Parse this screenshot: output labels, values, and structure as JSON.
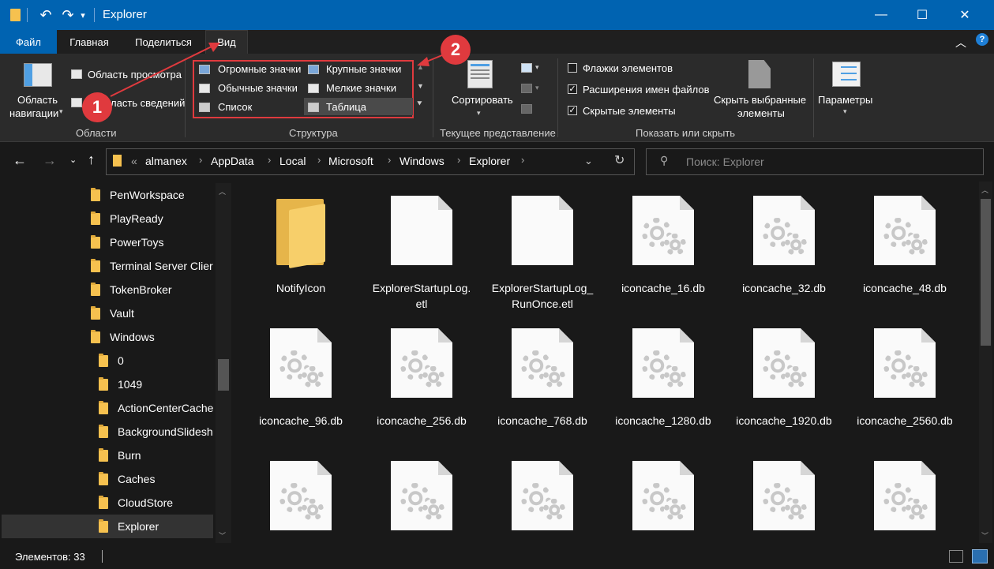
{
  "titlebar": {
    "title": "Explorer",
    "minimize": "—",
    "maximize": "☐",
    "close": "✕",
    "qa_undo": "↶",
    "qa_redo": "↷",
    "qa_more": "▾"
  },
  "tabs": [
    {
      "label": "Файл"
    },
    {
      "label": "Главная"
    },
    {
      "label": "Поделиться"
    },
    {
      "label": "Вид"
    }
  ],
  "ribbon": {
    "panes": {
      "nav_pane": [
        "Область",
        "навигации"
      ],
      "preview_pane": "Область просмотра",
      "details_pane": "ласть сведений",
      "group_label": "Области"
    },
    "layout": {
      "items": [
        "Огромные значки",
        "Крупные значки",
        "Обычные значки",
        "Мелкие значки",
        "Список",
        "Таблица"
      ],
      "group_label": "Структура"
    },
    "current_view": {
      "sort_label": "Сортировать",
      "group_label": "Текущее представление"
    },
    "show_hide": {
      "checkboxes": [
        {
          "label": "Флажки элементов",
          "checked": false
        },
        {
          "label": "Расширения имен файлов",
          "checked": true
        },
        {
          "label": "Скрытые элементы",
          "checked": true
        }
      ],
      "hide_selected": [
        "Скрыть выбранные",
        "элементы"
      ],
      "group_label": "Показать или скрыть"
    },
    "options_label": "Параметры"
  },
  "address": {
    "prefix": "«",
    "crumbs": [
      "almanex",
      "AppData",
      "Local",
      "Microsoft",
      "Windows",
      "Explorer"
    ],
    "search_placeholder": "Поиск: Explorer"
  },
  "tree": [
    {
      "label": "PenWorkspace",
      "level": 0
    },
    {
      "label": "PlayReady",
      "level": 0
    },
    {
      "label": "PowerToys",
      "level": 0
    },
    {
      "label": "Terminal Server Clier",
      "level": 0
    },
    {
      "label": "TokenBroker",
      "level": 0
    },
    {
      "label": "Vault",
      "level": 0
    },
    {
      "label": "Windows",
      "level": 0
    },
    {
      "label": "0",
      "level": 1
    },
    {
      "label": "1049",
      "level": 1
    },
    {
      "label": "ActionCenterCache",
      "level": 1
    },
    {
      "label": "BackgroundSlidesh",
      "level": 1
    },
    {
      "label": "Burn",
      "level": 1
    },
    {
      "label": "Caches",
      "level": 1
    },
    {
      "label": "CloudStore",
      "level": 1
    },
    {
      "label": "Explorer",
      "level": 1,
      "selected": true
    }
  ],
  "files": [
    {
      "name": "NotifyIcon",
      "type": "folder"
    },
    {
      "name": "ExplorerStartupLog.etl",
      "type": "doc"
    },
    {
      "name": "ExplorerStartupLog_RunOnce.etl",
      "type": "doc"
    },
    {
      "name": "iconcache_16.db",
      "type": "gear"
    },
    {
      "name": "iconcache_32.db",
      "type": "gear"
    },
    {
      "name": "iconcache_48.db",
      "type": "gear"
    },
    {
      "name": "iconcache_96.db",
      "type": "gear"
    },
    {
      "name": "iconcache_256.db",
      "type": "gear"
    },
    {
      "name": "iconcache_768.db",
      "type": "gear"
    },
    {
      "name": "iconcache_1280.db",
      "type": "gear"
    },
    {
      "name": "iconcache_1920.db",
      "type": "gear"
    },
    {
      "name": "iconcache_2560.db",
      "type": "gear"
    },
    {
      "name": "",
      "type": "gear"
    },
    {
      "name": "",
      "type": "gear"
    },
    {
      "name": "",
      "type": "gear"
    },
    {
      "name": "",
      "type": "gear"
    },
    {
      "name": "",
      "type": "gear"
    },
    {
      "name": "",
      "type": "gear"
    }
  ],
  "status": {
    "count": "Элементов: 33"
  },
  "annotations": {
    "badge1": "1",
    "badge2": "2",
    "color": "#e03a3e"
  }
}
